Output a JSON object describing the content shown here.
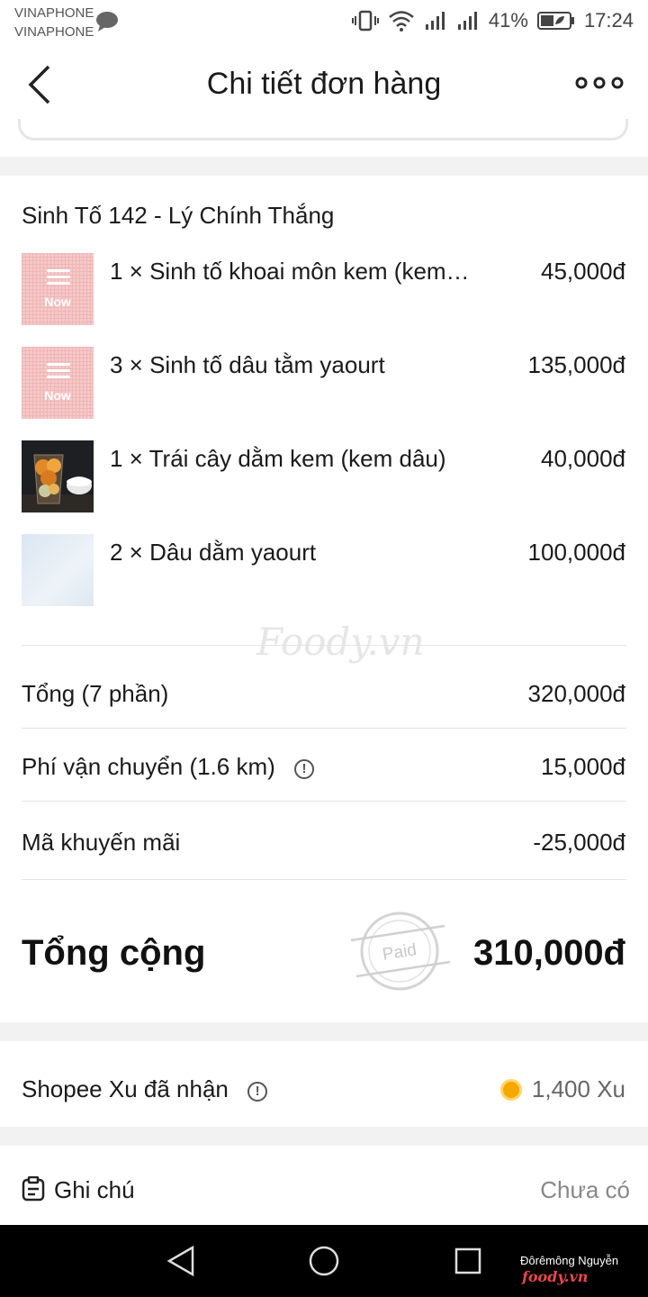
{
  "status_bar": {
    "carrier1": "VINAPHONE",
    "carrier2": "VINAPHONE",
    "battery": "41%",
    "time": "17:24"
  },
  "header": {
    "title": "Chi tiết đơn hàng"
  },
  "order": {
    "store": "Sinh Tố 142 - Lý Chính Thắng",
    "watermark": "Foody.vn",
    "items": [
      {
        "text": "1 × Sinh tố khoai môn kem (kem…",
        "price": "45,000đ",
        "image": "now-placeholder",
        "img_label": "Now"
      },
      {
        "text": "3 × Sinh tố dâu tằm yaourt",
        "price": "135,000đ",
        "image": "now-placeholder",
        "img_label": "Now"
      },
      {
        "text": "1 × Trái cây dằm kem (kem dâu)",
        "price": "40,000đ",
        "image": "fruit-photo"
      },
      {
        "text": "2 × Dâu dằm yaourt",
        "price": "100,000đ",
        "image": "light-blue-photo"
      }
    ],
    "subtotal_label": "Tổng (7 phần)",
    "subtotal_value": "320,000đ",
    "shipping_label": "Phí vận chuyển (1.6 km)",
    "shipping_value": "15,000đ",
    "promo_label": "Mã khuyến mãi",
    "promo_value": "-25,000đ",
    "total_label": "Tổng cộng",
    "total_value": "310,000đ",
    "paid_stamp": "Paid"
  },
  "coins": {
    "label": "Shopee Xu đã nhận",
    "value": "1,400 Xu"
  },
  "note": {
    "label": "Ghi chú",
    "value": "Chưa có"
  },
  "navbar": {
    "user": "Đôrêmông Nguyễn",
    "brand": "foody.vn"
  },
  "colors": {
    "coin": "#f7a800",
    "divider": "#e4e4e4",
    "now_pink": "#f5c9c9"
  }
}
